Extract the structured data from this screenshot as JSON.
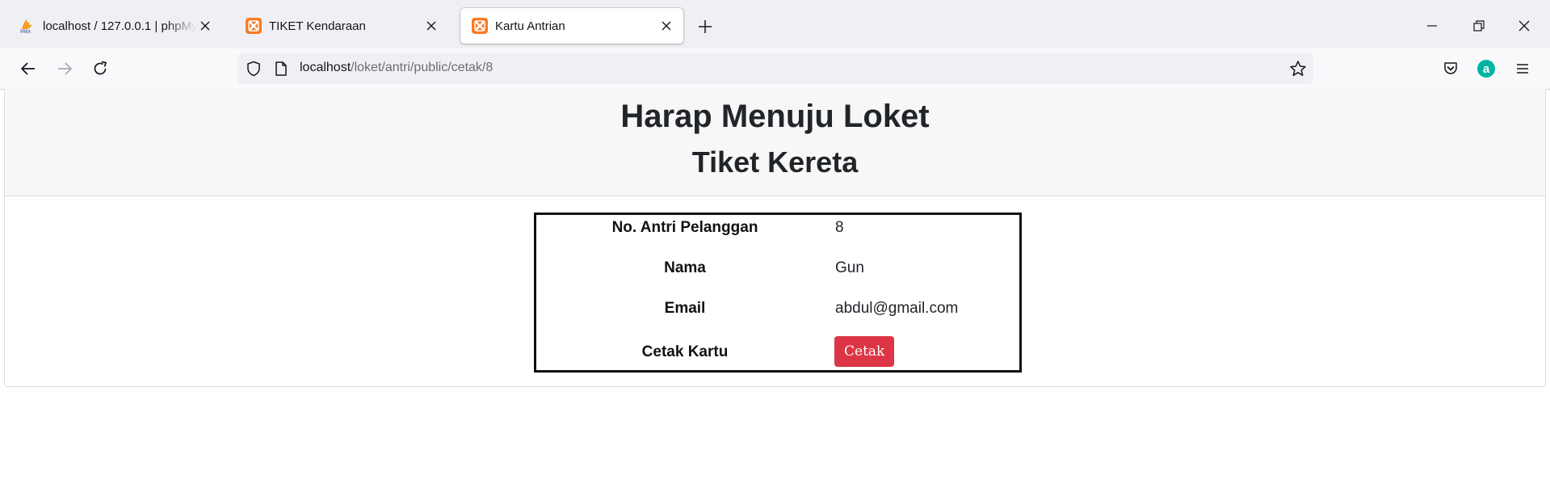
{
  "browser": {
    "tabs": [
      {
        "title": "localhost / 127.0.0.1 | phpMyAdmin",
        "icon": "phpmyadmin-icon",
        "active": false
      },
      {
        "title": "TIKET Kendaraan",
        "icon": "xampp-icon",
        "active": false
      },
      {
        "title": "Kartu Antrian",
        "icon": "xampp-icon",
        "active": true
      }
    ],
    "url": {
      "host": "localhost",
      "path": "/loket/antri/public/cetak/8"
    }
  },
  "page": {
    "headline": "Harap Menuju Loket",
    "subheadline": "Tiket Kereta",
    "fields": [
      {
        "label": "No. Antri Pelanggan",
        "value": "8"
      },
      {
        "label": "Nama",
        "value": "Gun"
      },
      {
        "label": "Email",
        "value": "abdul@gmail.com"
      }
    ],
    "print_label": "Cetak Kartu",
    "print_button": "Cetak"
  },
  "colors": {
    "button_danger": "#dc3545",
    "xampp_orange": "#fb7a24",
    "profile_teal": "#00b3a4"
  }
}
